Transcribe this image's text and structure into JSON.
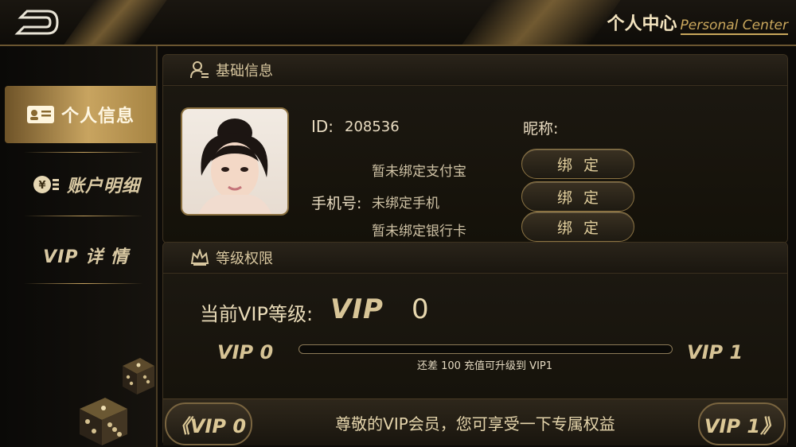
{
  "header": {
    "title_cn": "个人中心",
    "title_en": "Personal Center",
    "back_icon": "back-arrow-icon"
  },
  "sidebar": {
    "items": [
      {
        "label": "个人信息",
        "icon": "id-card-icon",
        "active": true
      },
      {
        "label": "账户明细",
        "icon": "yen-coin-icon",
        "active": false
      },
      {
        "label": "VIP 详 情",
        "icon": "",
        "active": false
      }
    ]
  },
  "basic_info": {
    "title": "基础信息",
    "id_label": "ID:",
    "id_value": "208536",
    "nickname_label": "昵称:",
    "alipay_status": "暂未绑定支付宝",
    "phone_label": "手机号:",
    "phone_status": "未绑定手机",
    "bankcard_status": "暂未绑定银行卡",
    "bind_label": "绑定"
  },
  "vip": {
    "title": "等级权限",
    "current_label": "当前VIP等级:",
    "current_vip_text": "VIP",
    "current_level": "0",
    "left_level": "VIP 0",
    "right_level": "VIP 1",
    "progress_fraction": 0,
    "progress_text": "还差 100 充值可升级到 VIP1",
    "prev_button": "《VIP 0",
    "next_button": "VIP 1》",
    "benefit_text": "尊敬的VIP会员，您可享受一下专属权益"
  },
  "colors": {
    "gold": "#c8a460",
    "background": "#0d0b08"
  }
}
